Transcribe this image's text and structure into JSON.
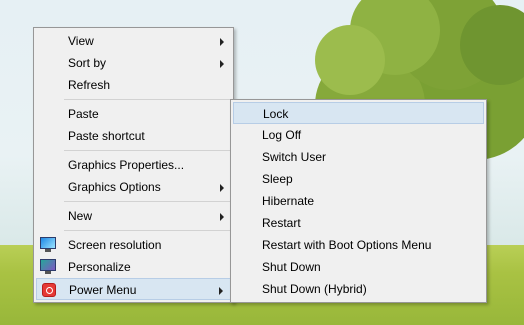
{
  "context_menu": {
    "items": [
      {
        "label": "View",
        "submenu": true
      },
      {
        "label": "Sort by",
        "submenu": true
      },
      {
        "label": "Refresh",
        "submenu": false
      },
      {
        "label": "Paste",
        "submenu": false
      },
      {
        "label": "Paste shortcut",
        "submenu": false
      },
      {
        "label": "Graphics Properties...",
        "submenu": false
      },
      {
        "label": "Graphics Options",
        "submenu": true
      },
      {
        "label": "New",
        "submenu": true
      },
      {
        "label": "Screen resolution",
        "icon": "screen-resolution-icon"
      },
      {
        "label": "Personalize",
        "icon": "personalize-icon"
      },
      {
        "label": "Power Menu",
        "icon": "power-icon",
        "submenu": true
      }
    ]
  },
  "power_submenu": {
    "items": [
      {
        "label": "Lock"
      },
      {
        "label": "Log Off"
      },
      {
        "label": "Switch User"
      },
      {
        "label": "Sleep"
      },
      {
        "label": "Hibernate"
      },
      {
        "label": "Restart"
      },
      {
        "label": "Restart with Boot Options Menu"
      },
      {
        "label": "Shut Down"
      },
      {
        "label": "Shut Down (Hybrid)"
      }
    ]
  }
}
